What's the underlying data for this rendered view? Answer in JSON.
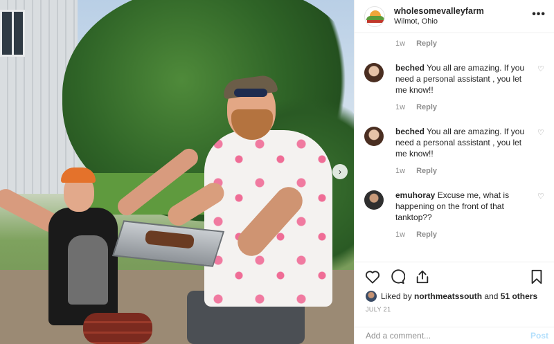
{
  "post": {
    "username": "wholesomevalleyfarm",
    "location": "Wilmot, Ohio",
    "more_glyph": "•••",
    "carousel_next_glyph": "›"
  },
  "comments": [
    {
      "user": "",
      "text": "",
      "time": "1w",
      "reply": "Reply"
    },
    {
      "user": "beched",
      "text": "You all are amazing. If you need a personal assistant , you let me know!!",
      "time": "1w",
      "reply": "Reply"
    },
    {
      "user": "beched",
      "text": "You all are amazing. If you need a personal assistant , you let me know!!",
      "time": "1w",
      "reply": "Reply"
    },
    {
      "user": "emuhoray",
      "text": "Excuse me, what is happening on the front of that tanktop??",
      "time": "1w",
      "reply": "Reply"
    }
  ],
  "actions": {
    "icons": [
      "heart-icon",
      "comment-icon",
      "share-icon",
      "bookmark-icon"
    ]
  },
  "likes": {
    "prefix": "Liked by",
    "user": "northmeatssouth",
    "and": "and",
    "others": "51 others"
  },
  "date": "JULY 21",
  "add_comment": {
    "placeholder": "Add a comment...",
    "post_label": "Post"
  },
  "colors": {
    "text": "#262626",
    "muted": "#8e8e8e",
    "post_disabled": "#b2dffc",
    "border": "#efefef"
  }
}
